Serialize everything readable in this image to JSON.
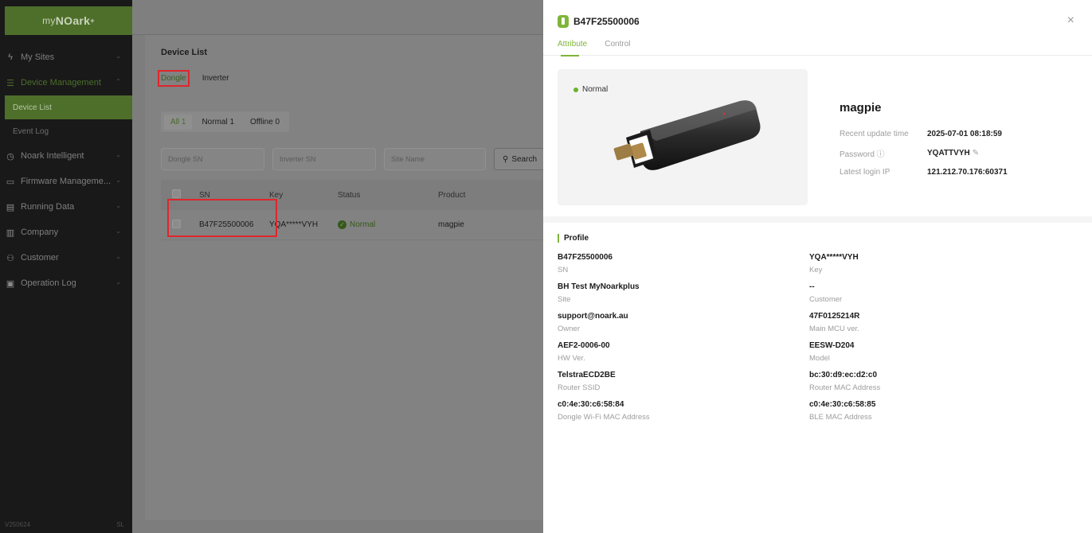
{
  "sidebar": {
    "logo": {
      "prefix": "my",
      "brand": "NOark",
      "suffix": "+"
    },
    "items": [
      {
        "label": "My Sites",
        "icon": "lightning-icon"
      },
      {
        "label": "Device Management",
        "icon": "device-list-icon"
      },
      {
        "label": "Device List"
      },
      {
        "label": "Event Log"
      },
      {
        "label": "Noark Intelligent",
        "icon": "clock-icon"
      },
      {
        "label": "Firmware Manageme...",
        "icon": "monitor-icon"
      },
      {
        "label": "Running Data",
        "icon": "chart-icon"
      },
      {
        "label": "Company",
        "icon": "building-icon"
      },
      {
        "label": "Customer",
        "icon": "users-icon"
      },
      {
        "label": "Operation Log",
        "icon": "log-icon"
      }
    ],
    "version": "V250624",
    "version_right": "SL"
  },
  "device_list": {
    "title": "Device List",
    "tabs": [
      "Dongle",
      "Inverter"
    ],
    "filters": [
      "All 1",
      "Normal 1",
      "Offline 0"
    ],
    "search": {
      "dongle_sn": "Dongle SN",
      "inverter_sn": "Inverter SN",
      "site_name": "Site Name",
      "button": "Search"
    },
    "columns": [
      "SN",
      "Key",
      "Status",
      "Product"
    ],
    "rows": [
      {
        "sn": "B47F25500006",
        "key": "YQA*****VYH",
        "status": "Normal",
        "product": "magpie"
      }
    ]
  },
  "drawer": {
    "title": "B47F25500006",
    "tabs": [
      "Attribute",
      "Control"
    ],
    "device_status": "Normal",
    "product_name": "magpie",
    "info": [
      {
        "label": "Recent update time",
        "value": "2025-07-01 08:18:59"
      },
      {
        "label": "Password ⓘ",
        "value": "YQATTVYH"
      },
      {
        "label": "Latest login IP",
        "value": "121.212.70.176:60371"
      }
    ],
    "profile_title": "Profile",
    "profile": [
      {
        "value": "B47F25500006",
        "label": "SN"
      },
      {
        "value": "YQA*****VYH",
        "label": "Key"
      },
      {
        "value": "BH Test MyNoarkplus",
        "label": "Site"
      },
      {
        "value": "--",
        "label": "Customer"
      },
      {
        "value": "support@noark.au",
        "label": "Owner"
      },
      {
        "value": "47F0125214R",
        "label": "Main MCU ver."
      },
      {
        "value": "AEF2-0006-00",
        "label": "HW Ver."
      },
      {
        "value": "EESW-D204",
        "label": "Model"
      },
      {
        "value": "TelstraECD2BE",
        "label": "Router SSID"
      },
      {
        "value": "bc:30:d9:ec:d2:c0",
        "label": "Router MAC Address"
      },
      {
        "value": "c0:4e:30:c6:58:84",
        "label": "Dongle Wi-Fi MAC Address"
      },
      {
        "value": "c0:4e:30:c6:58:85",
        "label": "BLE MAC Address"
      }
    ],
    "close": "×"
  },
  "colors": {
    "accent": "#7eb53a",
    "highlight": "#e0262b",
    "sidebar_bg": "#191919"
  }
}
